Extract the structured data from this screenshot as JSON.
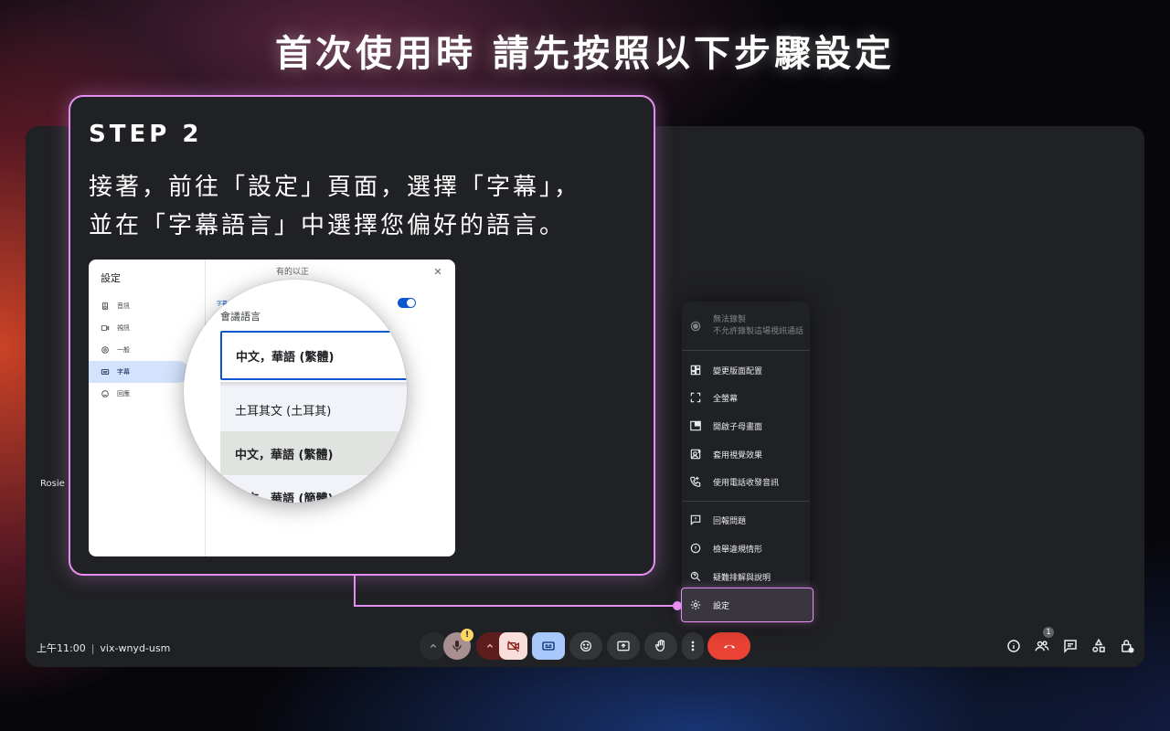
{
  "headline": "首次使用時 請先按照以下步驟設定",
  "callout": {
    "step": "STEP 2",
    "line1": "接著，前往「設定」頁面，選擇「字幕」，",
    "line2": "並在「字幕語言」中選擇您偏好的語言。"
  },
  "settings_shot": {
    "title": "設定",
    "sidebar": [
      {
        "label": "音訊",
        "icon": "speaker-icon"
      },
      {
        "label": "視訊",
        "icon": "video-icon"
      },
      {
        "label": "一般",
        "icon": "gear-icon"
      },
      {
        "label": "字幕",
        "icon": "captions-icon",
        "active": true
      },
      {
        "label": "回應",
        "icon": "emoji-icon"
      }
    ],
    "faint_top": "有的以正",
    "faint_caption": "字幕",
    "lens": {
      "label": "會議語言",
      "selected": "中文，華語 (繁體)",
      "options": [
        "土耳其文 (土耳其)",
        "中文，華語 (繁體)",
        "中文，華語 (簡體)"
      ]
    }
  },
  "tile_name": "Rosie",
  "bottom_left": {
    "time": "上午11:00",
    "separator": "|",
    "meeting_code": "vix-wnyd-usm"
  },
  "menu": {
    "recording": {
      "title": "無法錄製",
      "subtitle": "不允許錄製這場視訊通話"
    },
    "items": [
      {
        "label": "變更版面配置",
        "icon": "layout-icon"
      },
      {
        "label": "全螢幕",
        "icon": "fullscreen-icon"
      },
      {
        "label": "開啟子母畫面",
        "icon": "pip-icon"
      },
      {
        "label": "套用視覺效果",
        "icon": "effects-icon"
      },
      {
        "label": "使用電話收發音訊",
        "icon": "phone-icon"
      }
    ],
    "items2": [
      {
        "label": "回報問題",
        "icon": "feedback-icon"
      },
      {
        "label": "檢舉違規情形",
        "icon": "report-icon"
      },
      {
        "label": "疑難排解與說明",
        "icon": "help-icon"
      }
    ],
    "settings": {
      "label": "設定",
      "icon": "gear-icon"
    }
  },
  "controls": {
    "mic_warning": "!",
    "people_count": "1"
  },
  "colors": {
    "accent_pink": "#e58ef0",
    "meet_bg": "#202124",
    "end_call_red": "#ea4335",
    "captions_blue": "#a8c7fa",
    "cam_off_pink": "#f9dedc"
  }
}
